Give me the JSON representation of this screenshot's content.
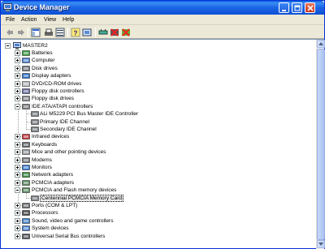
{
  "window": {
    "title": "Device Manager"
  },
  "menu": [
    "File",
    "Action",
    "View",
    "Help"
  ],
  "tree": {
    "root": "MASTER2",
    "categories": [
      {
        "label": "Batteries",
        "icon": "battery-icon",
        "expanded": false
      },
      {
        "label": "Computer",
        "icon": "computer-icon",
        "expanded": false
      },
      {
        "label": "Disk drives",
        "icon": "disk-drive-icon",
        "expanded": false
      },
      {
        "label": "Display adapters",
        "icon": "display-adapter-icon",
        "expanded": false
      },
      {
        "label": "DVD/CD-ROM drives",
        "icon": "cdrom-icon",
        "expanded": false
      },
      {
        "label": "Floppy disk controllers",
        "icon": "floppy-controller-icon",
        "expanded": false
      },
      {
        "label": "Floppy disk drives",
        "icon": "floppy-drive-icon",
        "expanded": false
      },
      {
        "label": "IDE ATA/ATAPI controllers",
        "icon": "ide-controller-icon",
        "expanded": true,
        "children": [
          "ALi M5229 PCI Bus Master IDE Controller",
          "Primary IDE Channel",
          "Secondary IDE Channel"
        ]
      },
      {
        "label": "Infrared devices",
        "icon": "infrared-icon",
        "expanded": false
      },
      {
        "label": "Keyboards",
        "icon": "keyboard-icon",
        "expanded": false
      },
      {
        "label": "Mice and other pointing devices",
        "icon": "mouse-icon",
        "expanded": false
      },
      {
        "label": "Modems",
        "icon": "modem-icon",
        "expanded": false
      },
      {
        "label": "Monitors",
        "icon": "monitor-icon",
        "expanded": false
      },
      {
        "label": "Network adapters",
        "icon": "network-adapter-icon",
        "expanded": false
      },
      {
        "label": "PCMCIA adapters",
        "icon": "pcmcia-adapter-icon",
        "expanded": false
      },
      {
        "label": "PCMCIA and Flash memory devices",
        "icon": "pcmcia-flash-icon",
        "expanded": true,
        "children": [
          "Centennial PCMCIA Memory Card"
        ]
      },
      {
        "label": "Ports (COM & LPT)",
        "icon": "ports-icon",
        "expanded": false
      },
      {
        "label": "Processors",
        "icon": "processor-icon",
        "expanded": false
      },
      {
        "label": "Sound, video and game controllers",
        "icon": "sound-icon",
        "expanded": false
      },
      {
        "label": "System devices",
        "icon": "system-device-icon",
        "expanded": false
      },
      {
        "label": "Universal Serial Bus controllers",
        "icon": "usb-icon",
        "expanded": false
      }
    ],
    "selected": "Centennial PCMCIA Memory Card"
  },
  "toolbar_icons": [
    "back-icon",
    "forward-icon",
    "properties-view-icon",
    "print-icon",
    "device-list-icon",
    "help-icon",
    "scan-hardware-icon",
    "update-driver-icon",
    "disable-device-icon",
    "uninstall-device-icon"
  ],
  "colors": {
    "titlebar": "#0a5fde",
    "window_bg": "#ece9d8",
    "selection_bg": "#e8e8e8"
  }
}
